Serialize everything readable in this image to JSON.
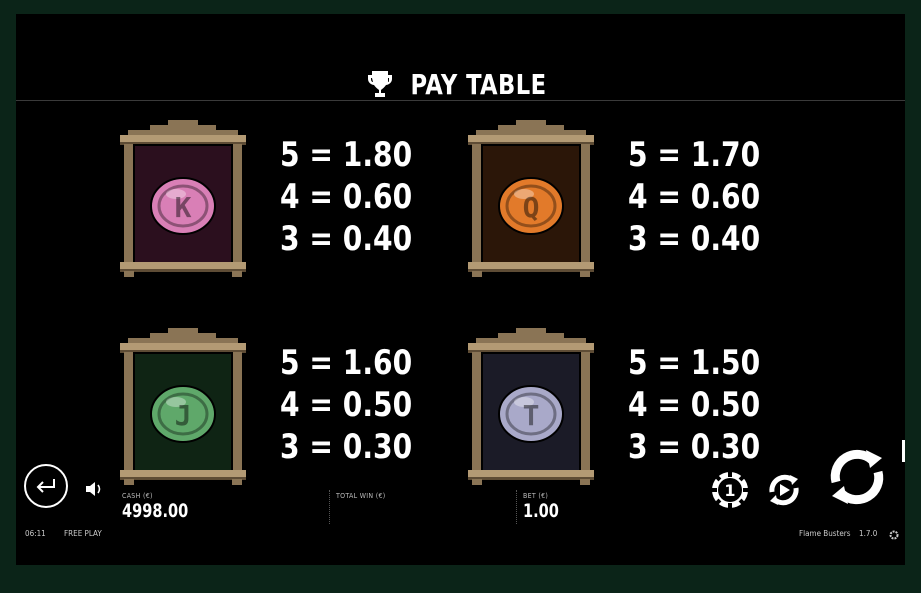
{
  "header": {
    "title": "PAY TABLE",
    "icon": "trophy-icon"
  },
  "symbols": [
    {
      "letter": "K",
      "color": "#d97fb6",
      "bg": "#2b0f1e",
      "pays": [
        "5 = 1.80",
        "4 = 0.60",
        "3 = 0.40"
      ]
    },
    {
      "letter": "Q",
      "color": "#e27a2a",
      "bg": "#2b1608",
      "pays": [
        "5 = 1.70",
        "4 = 0.60",
        "3 = 0.40"
      ]
    },
    {
      "letter": "J",
      "color": "#5fa86a",
      "bg": "#0f2414",
      "pays": [
        "5 = 1.60",
        "4 = 0.50",
        "3 = 0.30"
      ]
    },
    {
      "letter": "T",
      "color": "#a9a9c9",
      "bg": "#1b1b27",
      "pays": [
        "5 = 1.50",
        "4 = 0.50",
        "3 = 0.30"
      ]
    }
  ],
  "footer": {
    "cash_label": "CASH (€)",
    "cash_value": "4998.00",
    "total_win_label": "TOTAL WIN (€)",
    "bet_label": "BET (€)",
    "bet_value": "1.00",
    "time": "06:11",
    "mode": "FREE PLAY",
    "game_name": "Flame Busters",
    "version": "1.7.0",
    "bet_level": "1"
  },
  "colors": {
    "frame": "#8a7455",
    "frame_dark": "#5e4c35",
    "frame_light": "#b39a74",
    "page_border": "#0b2418"
  }
}
